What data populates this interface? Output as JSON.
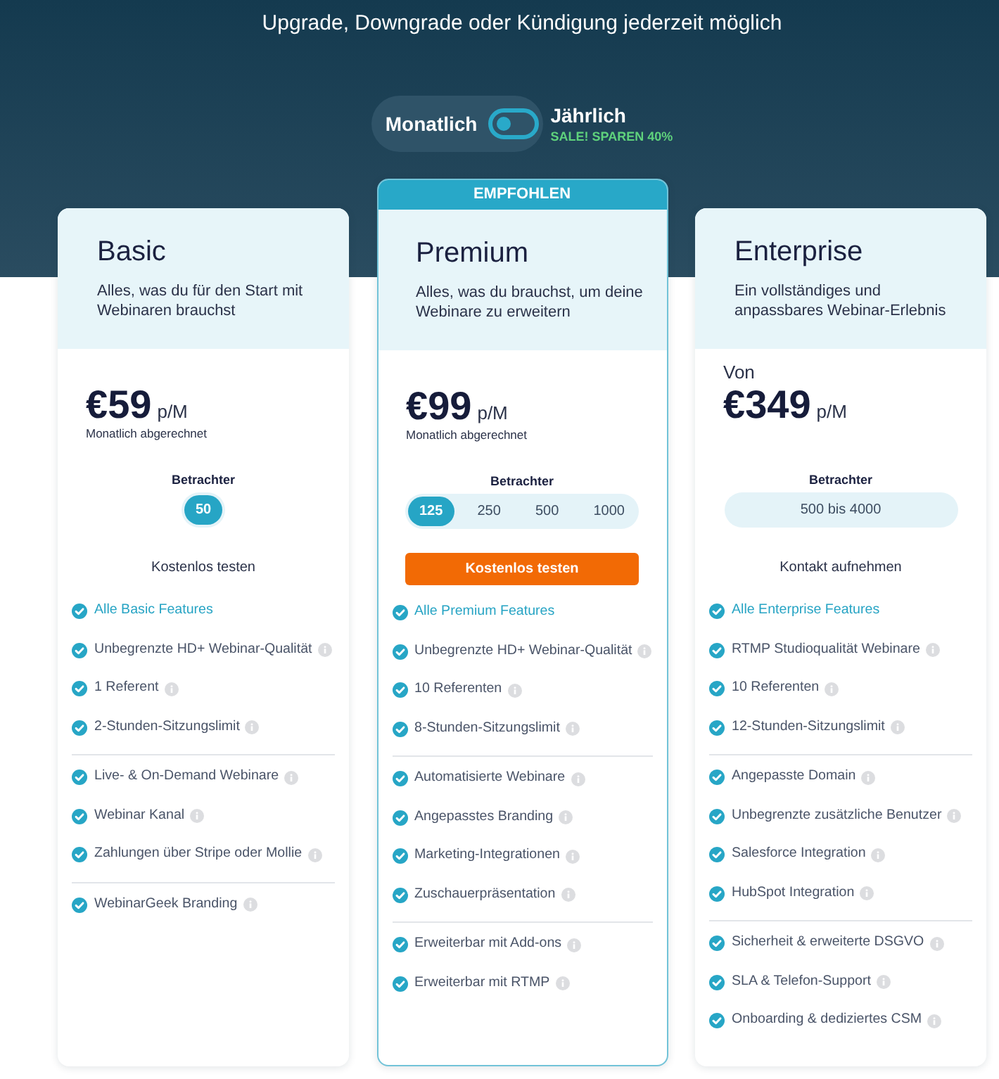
{
  "subtitle": "Upgrade, Downgrade oder Kündigung jederzeit möglich",
  "billing": {
    "monthly_label": "Monatlich",
    "yearly_label": "Jährlich",
    "sale_note": "SALE! SPAREN 40%",
    "yearly": false
  },
  "plans": [
    {
      "name": "Basic",
      "description": "Alles, was du für den Start mit Webinaren brauchst",
      "price": "€59",
      "unit": "p/M",
      "billing_note": "Monatlich abgerechnet",
      "viewers_label": "Betrachter",
      "viewer_options": [
        {
          "label": "50",
          "selected": true
        }
      ],
      "cta": {
        "label": "Kostenlos testen",
        "kind": "link"
      },
      "feature_groups": [
        [
          {
            "text": "Alle Basic Features",
            "kind": "link",
            "info": false
          },
          {
            "text": "Unbegrenzte HD+ Webinar-Qualität",
            "kind": "feature",
            "info": true
          },
          {
            "text": "1 Referent",
            "kind": "feature",
            "info": true
          },
          {
            "text": "2-Stunden-Sitzungslimit",
            "kind": "feature",
            "info": true
          }
        ],
        [
          {
            "text": "Live- & On-Demand Webinare",
            "kind": "feature",
            "info": true
          },
          {
            "text": "Webinar Kanal",
            "kind": "feature",
            "info": true
          },
          {
            "text": "Zahlungen über Stripe oder Mollie",
            "kind": "feature",
            "info": true
          }
        ],
        [
          {
            "text": "WebinarGeek Branding",
            "kind": "feature",
            "info": true
          }
        ]
      ]
    },
    {
      "badge": "EMPFOHLEN",
      "name": "Premium",
      "description": "Alles, was du brauchst, um deine Webinare zu erweitern",
      "price": "€99",
      "unit": "p/M",
      "billing_note": "Monatlich abgerechnet",
      "viewers_label": "Betrachter",
      "viewer_options": [
        {
          "label": "125",
          "selected": true
        },
        {
          "label": "250",
          "selected": false
        },
        {
          "label": "500",
          "selected": false
        },
        {
          "label": "1000",
          "selected": false
        }
      ],
      "cta": {
        "label": "Kostenlos testen",
        "kind": "button"
      },
      "feature_groups": [
        [
          {
            "text": "Alle Premium Features",
            "kind": "link",
            "info": false
          },
          {
            "text": "Unbegrenzte HD+ Webinar-Qualität",
            "kind": "feature",
            "info": true
          },
          {
            "text": "10 Referenten",
            "kind": "feature",
            "info": true
          },
          {
            "text": "8-Stunden-Sitzungslimit",
            "kind": "feature",
            "info": true
          }
        ],
        [
          {
            "text": "Automatisierte Webinare",
            "kind": "feature",
            "info": true
          },
          {
            "text": "Angepasstes Branding",
            "kind": "feature",
            "info": true
          },
          {
            "text": "Marketing-Integrationen",
            "kind": "feature",
            "info": true
          },
          {
            "text": "Zuschauerpräsentation",
            "kind": "feature",
            "info": true
          }
        ],
        [
          {
            "text": "Erweiterbar mit Add-ons",
            "kind": "feature",
            "info": true
          },
          {
            "text": "Erweiterbar mit RTMP",
            "kind": "feature",
            "info": true
          }
        ]
      ]
    },
    {
      "name": "Enterprise",
      "description": "Ein vollständiges und anpassbares Webinar-Erlebnis",
      "price_prefix": "Von",
      "price": "€349",
      "unit": "p/M",
      "viewers_label": "Betrachter",
      "viewer_options": [
        {
          "label": "500 bis 4000",
          "selected": false
        }
      ],
      "cta": {
        "label": "Kontakt aufnehmen",
        "kind": "link"
      },
      "feature_groups": [
        [
          {
            "text": "Alle Enterprise Features",
            "kind": "link",
            "info": false
          },
          {
            "text": "RTMP Studioqualität Webinare",
            "kind": "feature",
            "info": true
          },
          {
            "text": "10 Referenten",
            "kind": "feature",
            "info": true
          },
          {
            "text": "12-Stunden-Sitzungslimit",
            "kind": "feature",
            "info": true
          }
        ],
        [
          {
            "text": "Angepasste Domain",
            "kind": "feature",
            "info": true
          },
          {
            "text": "Unbegrenzte zusätzliche Benutzer",
            "kind": "feature",
            "info": true
          },
          {
            "text": "Salesforce Integration",
            "kind": "feature",
            "info": true
          },
          {
            "text": "HubSpot Integration",
            "kind": "feature",
            "info": true
          }
        ],
        [
          {
            "text": "Sicherheit & erweiterte DSGVO",
            "kind": "feature",
            "info": true
          },
          {
            "text": "SLA & Telefon-Support",
            "kind": "feature",
            "info": true
          },
          {
            "text": "Onboarding & dediziertes CSM",
            "kind": "feature",
            "info": true
          }
        ]
      ]
    }
  ]
}
